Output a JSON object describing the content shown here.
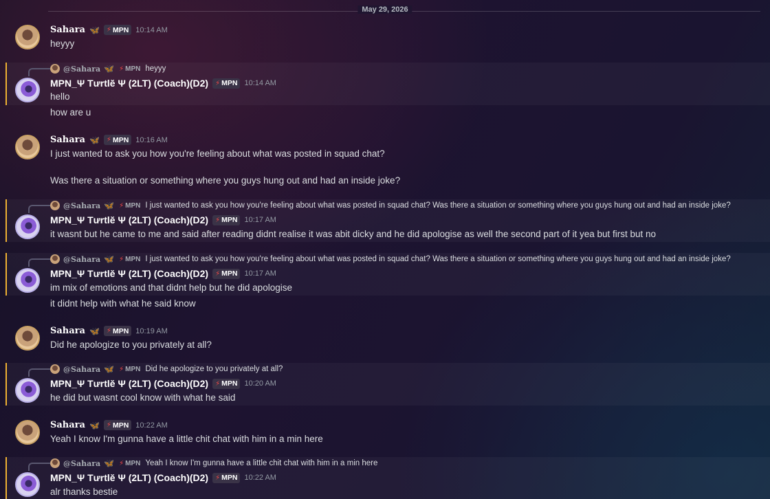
{
  "date_divider": "May 29, 2026",
  "messages": [
    {
      "author": "Sahara",
      "badge": "MPN",
      "time": "10:14 AM",
      "lines": [
        "heyyy"
      ]
    },
    {
      "author": "MPN_Ψ Tưrtlĕ Ψ (2LT) (Coach)(D2)",
      "badge": "MPN",
      "time": "10:14 AM",
      "reply": {
        "name": "@Sahara",
        "badge": "MPN",
        "text": "heyyy"
      },
      "lines": [
        "hello",
        "how are u"
      ]
    },
    {
      "author": "Sahara",
      "badge": "MPN",
      "time": "10:16 AM",
      "lines": [
        "I just wanted to ask you how you're feeling about what was posted in squad chat?",
        "Was there a situation or something where you guys hung out and had an inside joke?"
      ]
    },
    {
      "author": "MPN_Ψ Tưrtlĕ Ψ (2LT) (Coach)(D2)",
      "badge": "MPN",
      "time": "10:17 AM",
      "reply": {
        "name": "@Sahara",
        "badge": "MPN",
        "text": "I just wanted to ask you how you're feeling about what was posted in squad chat?  Was there a situation or something where you guys hung out and had an inside joke?"
      },
      "lines": [
        "it wasnt but he came to me and said after reading didnt realise it was abit dicky and he did apologise as well the second part of it yea but first but no"
      ]
    },
    {
      "author": "MPN_Ψ Tưrtlĕ Ψ (2LT) (Coach)(D2)",
      "badge": "MPN",
      "time": "10:17 AM",
      "reply": {
        "name": "@Sahara",
        "badge": "MPN",
        "text": "I just wanted to ask you how you're feeling about what was posted in squad chat?  Was there a situation or something where you guys hung out and had an inside joke?"
      },
      "lines": [
        "im mix of emotions and that didnt help but he did apologise",
        "it didnt help with what he said know"
      ]
    },
    {
      "author": "Sahara",
      "badge": "MPN",
      "time": "10:19 AM",
      "lines": [
        "Did he apologize to you privately at all?"
      ]
    },
    {
      "author": "MPN_Ψ Tưrtlĕ Ψ (2LT) (Coach)(D2)",
      "badge": "MPN",
      "time": "10:20 AM",
      "reply": {
        "name": "@Sahara",
        "badge": "MPN",
        "text": "Did he apologize to you privately at all?"
      },
      "lines": [
        "he did but wasnt cool know with what he said"
      ]
    },
    {
      "author": "Sahara",
      "badge": "MPN",
      "time": "10:22 AM",
      "lines": [
        "Yeah I know I'm gunna have a little chit chat with him in a min here"
      ]
    },
    {
      "author": "MPN_Ψ Tưrtlĕ Ψ (2LT) (Coach)(D2)",
      "badge": "MPN",
      "time": "10:22 AM",
      "reply": {
        "name": "@Sahara",
        "badge": "MPN",
        "text": "Yeah I know I'm gunna have a little chit chat with him in a min here"
      },
      "lines": [
        "alr thanks bestie"
      ]
    }
  ]
}
